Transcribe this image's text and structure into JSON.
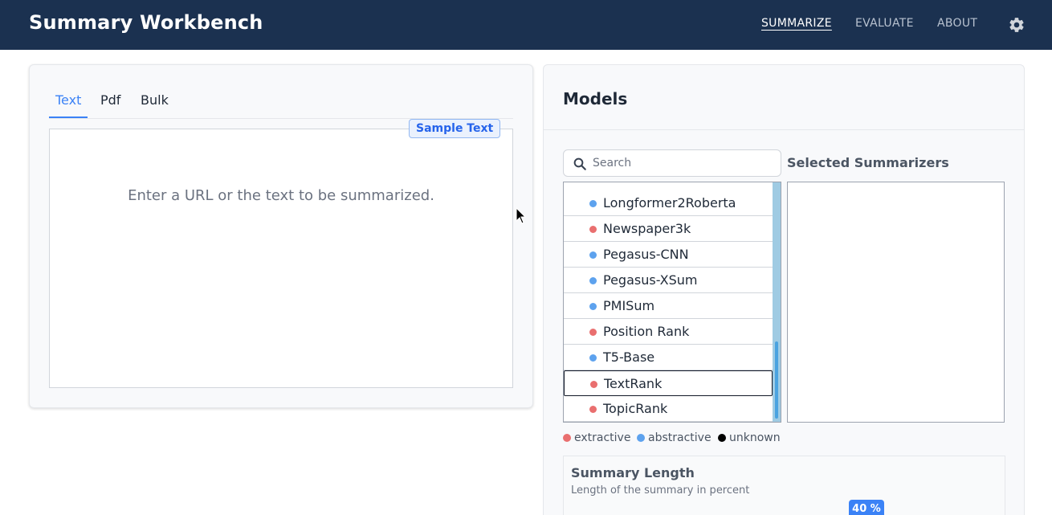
{
  "app": {
    "title": "Summary Workbench"
  },
  "nav": {
    "summarize": "SUMMARIZE",
    "evaluate": "EVALUATE",
    "about": "ABOUT",
    "settings_icon": "gear-icon"
  },
  "input": {
    "tabs": [
      "Text",
      "Pdf",
      "Bulk"
    ],
    "active_tab": "Text",
    "sample_label": "Sample Text",
    "placeholder": "Enter a URL or the text to be summarized."
  },
  "models": {
    "title": "Models",
    "search_placeholder": "Search",
    "selected_title": "Selected Summarizers",
    "items": [
      {
        "label": "Longformer2Roberta",
        "kind": "abstractive"
      },
      {
        "label": "Newspaper3k",
        "kind": "extractive"
      },
      {
        "label": "Pegasus-CNN",
        "kind": "abstractive"
      },
      {
        "label": "Pegasus-XSum",
        "kind": "abstractive"
      },
      {
        "label": "PMISum",
        "kind": "abstractive"
      },
      {
        "label": "Position Rank",
        "kind": "extractive"
      },
      {
        "label": "T5-Base",
        "kind": "abstractive"
      },
      {
        "label": "TextRank",
        "kind": "extractive"
      },
      {
        "label": "TopicRank",
        "kind": "extractive"
      }
    ],
    "focused_item": "TextRank",
    "scroll_position": 0.66,
    "legend": {
      "extractive": "extractive",
      "abstractive": "abstractive",
      "unknown": "unknown"
    }
  },
  "summary_length": {
    "title": "Summary Length",
    "description": "Length of the summary in percent",
    "value_label": "40 %",
    "value": 40
  },
  "colors": {
    "header_bg": "#1b3150",
    "accent": "#3b82f6",
    "extractive": "#e96f6f",
    "abstractive": "#5da2ee",
    "unknown": "#000000"
  }
}
